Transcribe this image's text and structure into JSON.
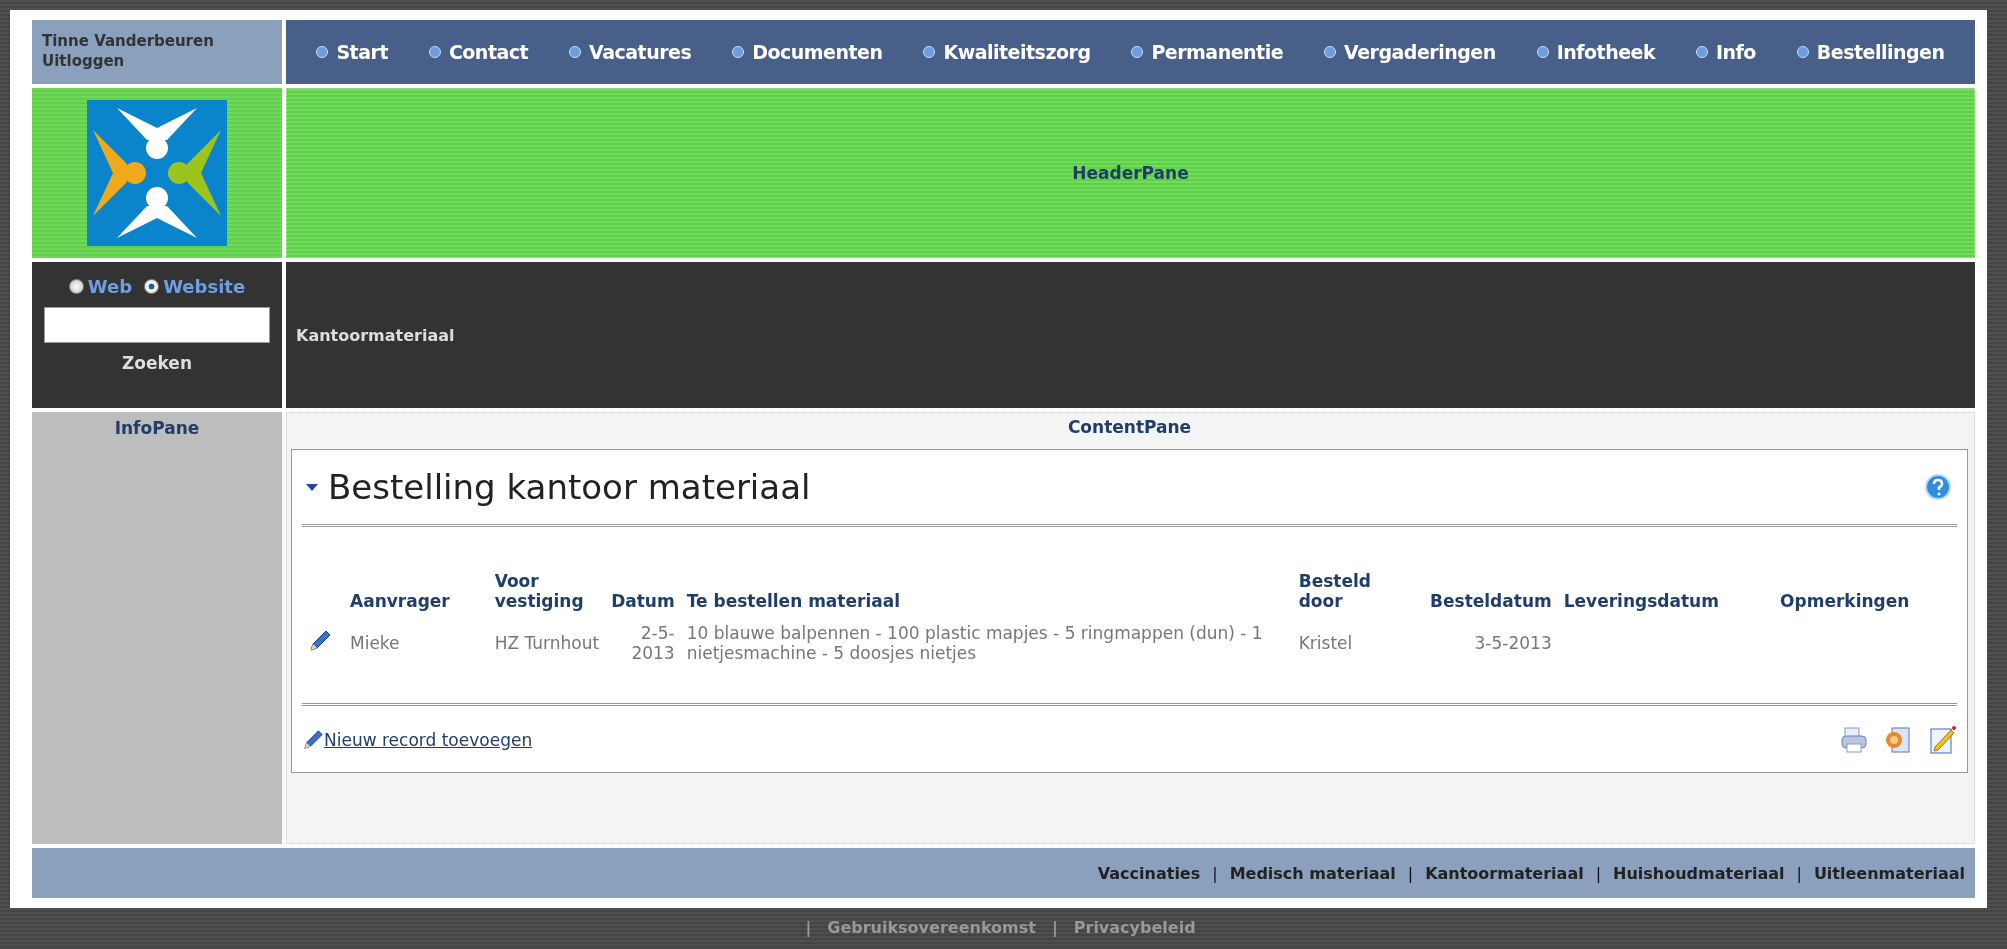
{
  "user": {
    "name": "Tinne Vanderbeuren",
    "logout": "Uitloggen"
  },
  "nav": [
    "Start",
    "Contact",
    "Vacatures",
    "Documenten",
    "Kwaliteitszorg",
    "Permanentie",
    "Vergaderingen",
    "Infotheek",
    "Info",
    "Bestellingen"
  ],
  "header_pane": "HeaderPane",
  "search": {
    "options": [
      {
        "label": "Web",
        "selected": false
      },
      {
        "label": "Website",
        "selected": true
      }
    ],
    "button": "Zoeken"
  },
  "breadcrumb": "Kantoormateriaal",
  "info_pane": "InfoPane",
  "content_pane": "ContentPane",
  "module": {
    "title": "Bestelling kantoor materiaal",
    "expanded": true,
    "columns": [
      "Aanvrager",
      "Voor vestiging",
      "Datum",
      "Te bestellen materiaal",
      "Besteld door",
      "Besteldatum",
      "Leveringsdatum",
      "Opmerkingen"
    ],
    "rows": [
      {
        "cells": [
          "Mieke",
          "HZ Turnhout",
          "2-5-2013",
          "10 blauwe balpennen - 100 plastic mapjes - 5 ringmappen (dun) - 1 nietjesmachine - 5 doosjes nietjes",
          "Kristel",
          "3-5-2013",
          "",
          ""
        ]
      }
    ],
    "add_link": "Nieuw record toevoegen"
  },
  "footer_links": [
    {
      "kind": "link",
      "text": "Vaccinaties"
    },
    {
      "kind": "separator",
      "text": "|"
    },
    {
      "kind": "link",
      "text": "Medisch materiaal"
    },
    {
      "kind": "separator",
      "text": "|"
    },
    {
      "kind": "link",
      "text": "Kantoormateriaal"
    },
    {
      "kind": "separator",
      "text": "|"
    },
    {
      "kind": "link",
      "text": "Huishoudmateriaal"
    },
    {
      "kind": "separator",
      "text": "|"
    },
    {
      "kind": "link",
      "text": "Uitleenmateriaal"
    }
  ],
  "bottom_links": [
    {
      "kind": "separator",
      "text": "|"
    },
    {
      "kind": "link",
      "text": "Gebruiksovereenkomst"
    },
    {
      "kind": "separator",
      "text": "|"
    },
    {
      "kind": "link",
      "text": "Privacybeleid"
    }
  ]
}
